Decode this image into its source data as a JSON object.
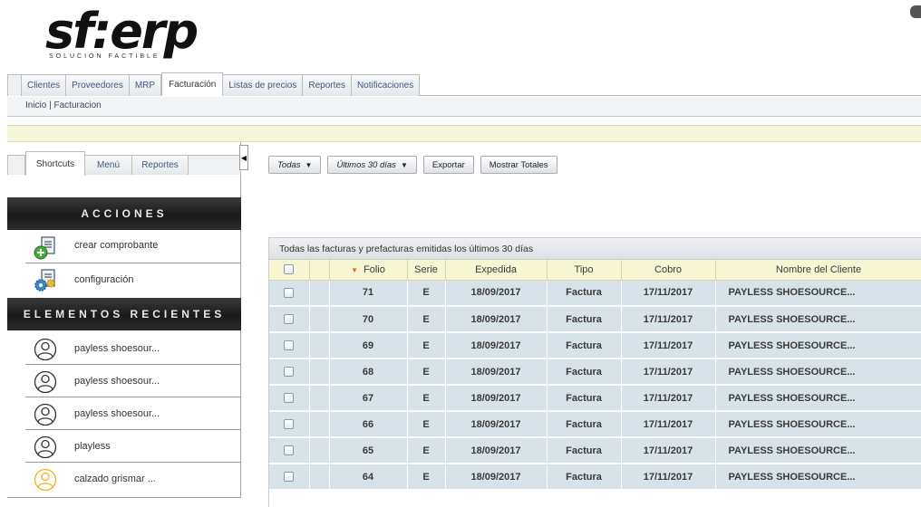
{
  "logo": {
    "text": "sf:erp",
    "subtitle": "SOLUCIÓN FACTIBLE"
  },
  "topnav": {
    "tabs": [
      {
        "label": "Clientes",
        "active": false
      },
      {
        "label": "Proveedores",
        "active": false
      },
      {
        "label": "MRP",
        "active": false
      },
      {
        "label": "Facturación",
        "active": true
      },
      {
        "label": "Listas de precios",
        "active": false
      },
      {
        "label": "Reportes",
        "active": false
      },
      {
        "label": "Notificaciones",
        "active": false
      }
    ]
  },
  "breadcrumb": "Inicio | Facturacion",
  "sidebar": {
    "tabs": [
      {
        "label": "Shortcuts",
        "active": true
      },
      {
        "label": "Menú",
        "active": false
      },
      {
        "label": "Reportes",
        "active": false
      }
    ],
    "actions_title": "ACCIONES",
    "actions": [
      {
        "label": "crear comprobante",
        "icon": "add-document-icon"
      },
      {
        "label": "configuración",
        "icon": "settings-document-icon"
      }
    ],
    "recent_title": "ELEMENTOS RECIENTES",
    "recent": [
      {
        "label": "payless shoesour...",
        "icon": "user-icon",
        "color": "#333333"
      },
      {
        "label": "payless shoesour...",
        "icon": "user-icon",
        "color": "#333333"
      },
      {
        "label": "payless shoesour...",
        "icon": "user-icon",
        "color": "#333333"
      },
      {
        "label": "playless",
        "icon": "user-icon",
        "color": "#333333"
      },
      {
        "label": "calzado grismar ...",
        "icon": "user-icon",
        "color": "#f3b01b"
      }
    ]
  },
  "toolbar": {
    "filter_all": "Todas",
    "filter_period": "Últimos 30 días",
    "export": "Exportar",
    "show_totals": "Mostrar Totales"
  },
  "grid": {
    "title": "Todas las facturas y prefacturas emitidas los últimos 30 días",
    "columns": {
      "folio": "Folio",
      "serie": "Serie",
      "expedida": "Expedida",
      "tipo": "Tipo",
      "cobro": "Cobro",
      "cliente": "Nombre del Cliente"
    },
    "rows": [
      {
        "folio": "71",
        "serie": "E",
        "expedida": "18/09/2017",
        "tipo": "Factura",
        "cobro": "17/11/2017",
        "cliente": "PAYLESS SHOESOURCE..."
      },
      {
        "folio": "70",
        "serie": "E",
        "expedida": "18/09/2017",
        "tipo": "Factura",
        "cobro": "17/11/2017",
        "cliente": "PAYLESS SHOESOURCE..."
      },
      {
        "folio": "69",
        "serie": "E",
        "expedida": "18/09/2017",
        "tipo": "Factura",
        "cobro": "17/11/2017",
        "cliente": "PAYLESS SHOESOURCE..."
      },
      {
        "folio": "68",
        "serie": "E",
        "expedida": "18/09/2017",
        "tipo": "Factura",
        "cobro": "17/11/2017",
        "cliente": "PAYLESS SHOESOURCE..."
      },
      {
        "folio": "67",
        "serie": "E",
        "expedida": "18/09/2017",
        "tipo": "Factura",
        "cobro": "17/11/2017",
        "cliente": "PAYLESS SHOESOURCE..."
      },
      {
        "folio": "66",
        "serie": "E",
        "expedida": "18/09/2017",
        "tipo": "Factura",
        "cobro": "17/11/2017",
        "cliente": "PAYLESS SHOESOURCE..."
      },
      {
        "folio": "65",
        "serie": "E",
        "expedida": "18/09/2017",
        "tipo": "Factura",
        "cobro": "17/11/2017",
        "cliente": "PAYLESS SHOESOURCE..."
      },
      {
        "folio": "64",
        "serie": "E",
        "expedida": "18/09/2017",
        "tipo": "Factura",
        "cobro": "17/11/2017",
        "cliente": "PAYLESS SHOESOURCE..."
      }
    ]
  },
  "colors": {
    "header_row": "#f8f7d4",
    "data_row": "#d7e3e8",
    "section_head": "#1a1a1a",
    "notice_bar": "#f6f7d8",
    "sort_arrow": "#e46a15"
  }
}
